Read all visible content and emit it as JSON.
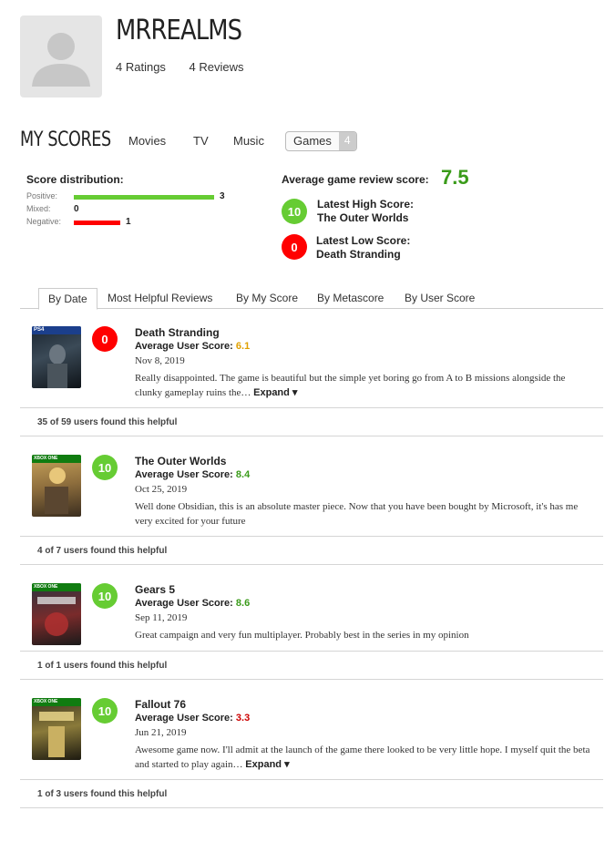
{
  "profile": {
    "username": "MRREALMS",
    "ratings_text": "4 Ratings",
    "reviews_text": "4 Reviews"
  },
  "my_scores": {
    "heading": "MY SCORES",
    "categories": [
      "Movies",
      "TV",
      "Music"
    ],
    "active_category": "Games",
    "active_count": "4"
  },
  "distribution": {
    "title": "Score distribution:",
    "rows": [
      {
        "label": "Positive:",
        "value": "3",
        "color": "#66cc33",
        "fraction": 1.0
      },
      {
        "label": "Mixed:",
        "value": "0",
        "color": "#ffcc33",
        "fraction": 0.0
      },
      {
        "label": "Negative:",
        "value": "1",
        "color": "#ff0000",
        "fraction": 0.333
      }
    ]
  },
  "average": {
    "label": "Average game review score:",
    "value": "7.5"
  },
  "latest_high": {
    "score": "10",
    "label": "Latest High Score:",
    "title": "The Outer Worlds"
  },
  "latest_low": {
    "score": "0",
    "label": "Latest Low Score:",
    "title": "Death Stranding"
  },
  "sort_tabs": [
    "By Date",
    "Most Helpful Reviews",
    "By My Score",
    "By Metascore",
    "By User Score"
  ],
  "reviews": [
    {
      "score": "0",
      "title": "Death Stranding",
      "avg_label": "Average User Score:",
      "avg_value": "6.1",
      "avg_color": "#e0a000",
      "date": "Nov 8, 2019",
      "body": "Really disappointed. The game is beautiful but the simple yet boring go from A to B missions alongside the clunky gameplay ruins the…",
      "expand": "Expand ▾",
      "helpful": "35 of 59 users found this helpful",
      "platform": "PS4"
    },
    {
      "score": "10",
      "title": "The Outer Worlds",
      "avg_label": "Average User Score:",
      "avg_value": "8.4",
      "avg_color": "#3a9b1a",
      "date": "Oct 25, 2019",
      "body": "Well done Obsidian, this is an absolute master piece. Now that you have been bought by Microsoft, it's has me very excited for your future",
      "expand": "",
      "helpful": "4 of 7 users found this helpful",
      "platform": "XBOX ONE"
    },
    {
      "score": "10",
      "title": "Gears 5",
      "avg_label": "Average User Score:",
      "avg_value": "8.6",
      "avg_color": "#3a9b1a",
      "date": "Sep 11, 2019",
      "body": "Great campaign and very fun multiplayer. Probably best in the series in my opinion",
      "expand": "",
      "helpful": "1 of 1 users found this helpful",
      "platform": "XBOX ONE"
    },
    {
      "score": "10",
      "title": "Fallout 76",
      "avg_label": "Average User Score:",
      "avg_value": "3.3",
      "avg_color": "#cc0000",
      "date": "Jun 21, 2019",
      "body": "Awesome game now. I'll admit at the launch of the game there looked to be very little hope. I myself quit the beta and started to play again…",
      "expand": "Expand ▾",
      "helpful": "1 of 3 users found this helpful",
      "platform": "XBOX ONE"
    }
  ]
}
